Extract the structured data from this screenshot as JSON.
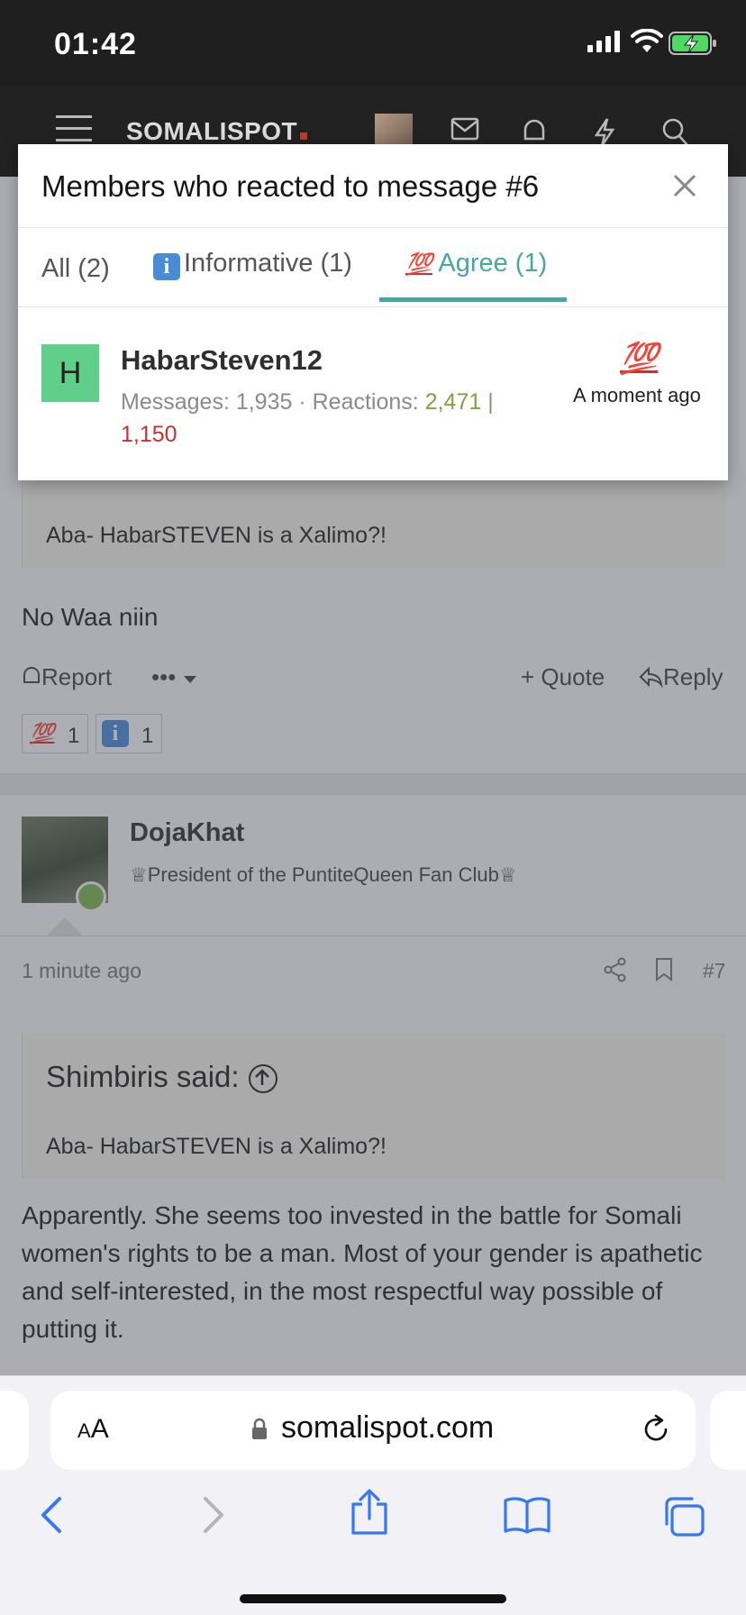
{
  "status_bar": {
    "time": "01:42"
  },
  "site": {
    "logo": "SOMALISPOT"
  },
  "modal": {
    "title": "Members who reacted to message #6",
    "tabs": [
      {
        "label": "All (2)"
      },
      {
        "label": "Informative (1)"
      },
      {
        "label": "Agree (1)"
      }
    ],
    "active_tab": "Agree (1)",
    "member": {
      "avatar_letter": "H",
      "name": "HabarSteven12",
      "messages_label": "Messages: 1,935 · Reactions:",
      "reactions_positive": "2,471",
      "separator": "|",
      "reactions_negative": "1,150",
      "reaction_emoji": "💯",
      "time": "A moment ago"
    }
  },
  "post6": {
    "quote_text": "Aba- HabarSTEVEN is a Xalimo?!",
    "text": "No Waa niin",
    "actions": {
      "report": "Report",
      "more": "•••",
      "quote": "Quote",
      "reply": "Reply"
    },
    "reactions": [
      {
        "emoji": "💯",
        "count": "1"
      },
      {
        "emoji": "i",
        "count": "1"
      }
    ]
  },
  "post7": {
    "author": "DojaKhat",
    "user_title": "♕President of the PuntiteQueen Fan Club♕",
    "time": "1 minute ago",
    "post_number": "#7",
    "quote_author": "Shimbiris said:",
    "quote_text": "Aba- HabarSTEVEN is a Xalimo?!",
    "text": "Apparently. She seems too invested in the battle for Somali women's rights to be a man. Most of your gender is apathetic and self-interested, in the most respectful way possible of putting it."
  },
  "browser": {
    "text_size_label": "AA",
    "url": "somalispot.com"
  }
}
